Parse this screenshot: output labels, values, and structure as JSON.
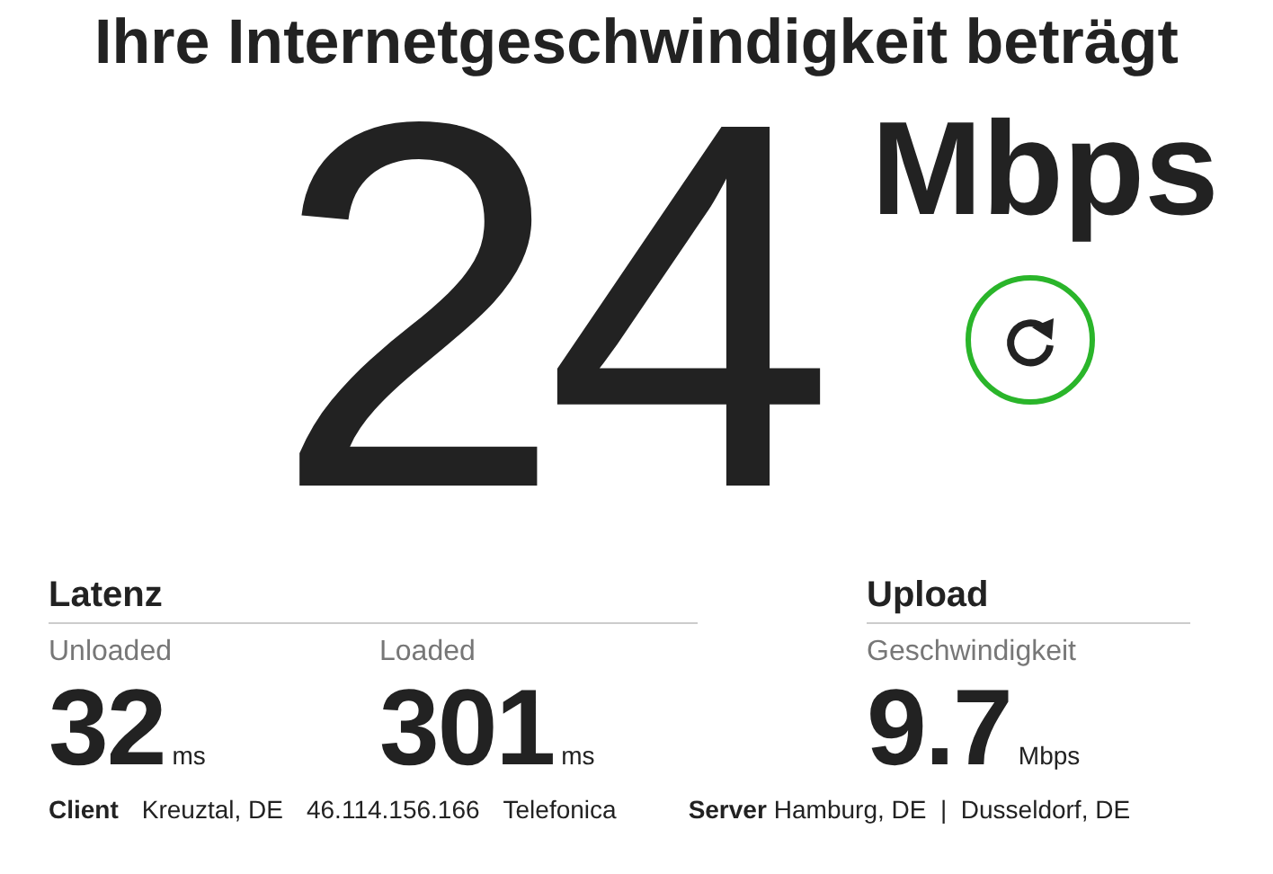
{
  "heading": "Ihre Internetgeschwindigkeit beträgt",
  "speed": {
    "value": "24",
    "unit": "Mbps"
  },
  "groups": [
    {
      "title": "Latenz",
      "metrics": [
        {
          "label": "Unloaded",
          "value": "32",
          "unit": "ms"
        },
        {
          "label": "Loaded",
          "value": "301",
          "unit": "ms"
        }
      ]
    },
    {
      "title": "Upload",
      "metrics": [
        {
          "label": "Geschwindigkeit",
          "value": "9.7",
          "unit": "Mbps"
        }
      ]
    }
  ],
  "client": {
    "label": "Client",
    "items": [
      "Kreuztal, DE",
      "46.114.156.166",
      "Telefonica"
    ]
  },
  "server": {
    "label": "Server",
    "text": "Hamburg, DE  |  Dusseldorf, DE"
  }
}
